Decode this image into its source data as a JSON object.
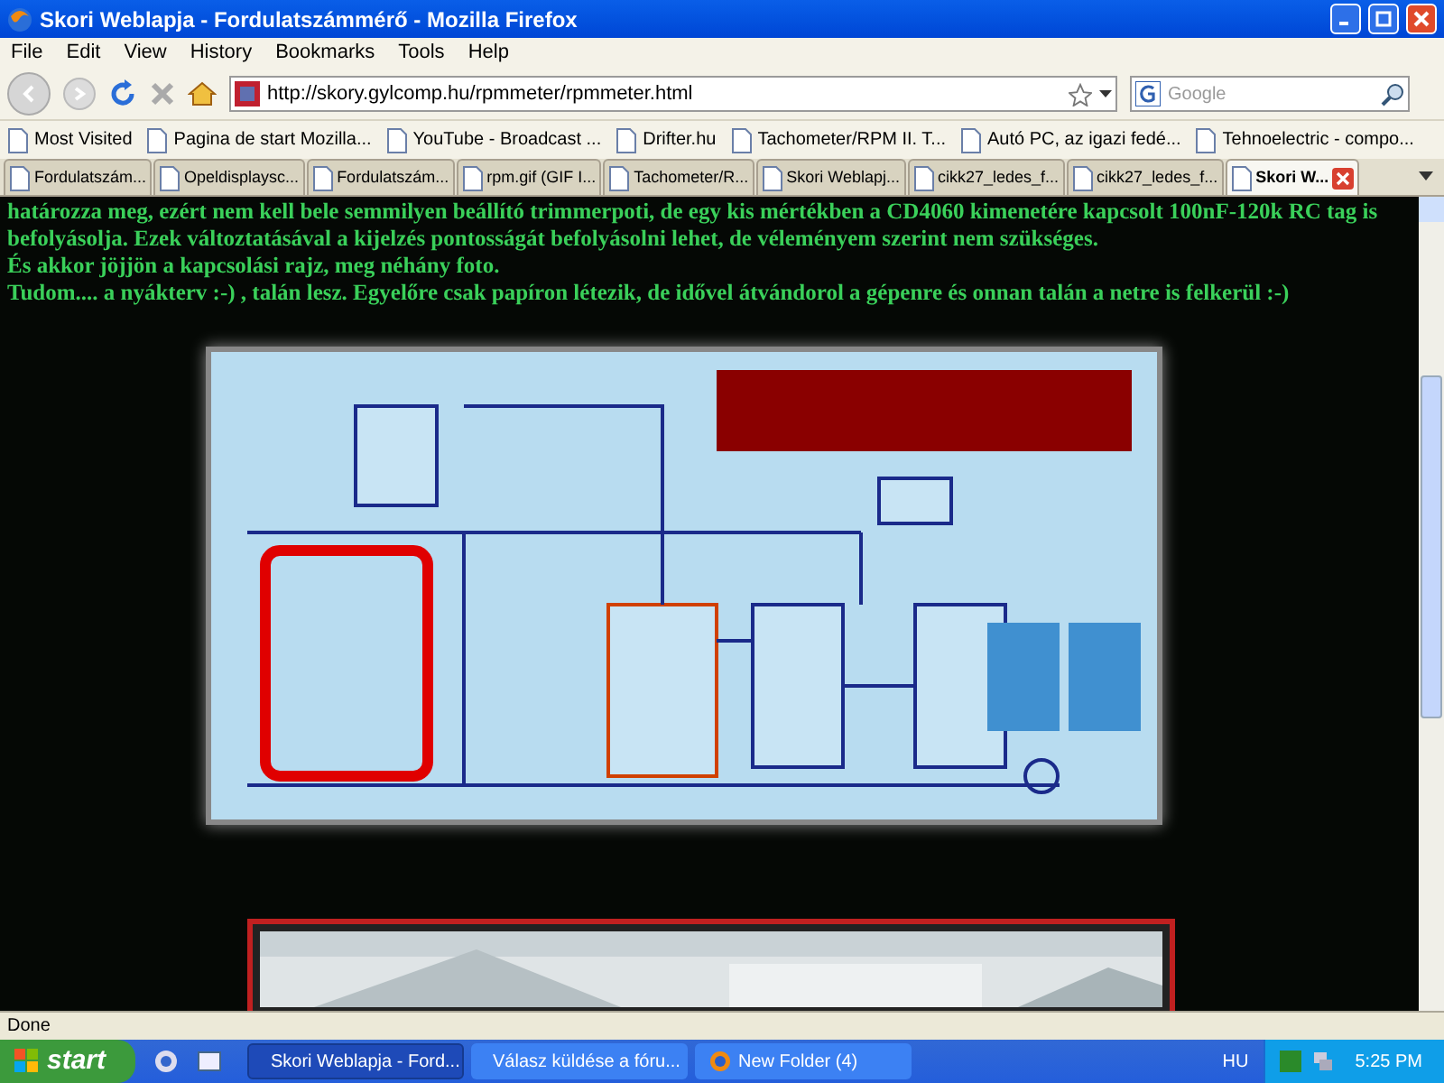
{
  "window": {
    "title": "Skori Weblapja - Fordulatszámmérő - Mozilla Firefox"
  },
  "menu": [
    "File",
    "Edit",
    "View",
    "History",
    "Bookmarks",
    "Tools",
    "Help"
  ],
  "toolbar": {
    "url": "http://skory.gylcomp.hu/rpmmeter/rpmmeter.html",
    "search_placeholder": "Google"
  },
  "bookmarks": [
    "Most Visited",
    "Pagina de start Mozilla...",
    "YouTube - Broadcast ...",
    "Drifter.hu",
    "Tachometer/RPM II. T...",
    "Autó PC, az igazi fedé...",
    "Tehnoelectric - compo..."
  ],
  "tabs": [
    {
      "label": "Fordulatszám...",
      "selected": false
    },
    {
      "label": "Opeldisplaysc...",
      "selected": false
    },
    {
      "label": "Fordulatszám...",
      "selected": false
    },
    {
      "label": "rpm.gif (GIF I...",
      "selected": false
    },
    {
      "label": "Tachometer/R...",
      "selected": false
    },
    {
      "label": "Skori Weblapj...",
      "selected": false
    },
    {
      "label": "cikk27_ledes_f...",
      "selected": false
    },
    {
      "label": "cikk27_ledes_f...",
      "selected": false
    },
    {
      "label": "Skori W...",
      "selected": true
    }
  ],
  "page": {
    "paragraphs": [
      "határozza meg, ezért nem kell bele semmilyen beállító trimmerpoti, de egy kis mértékben a CD4060 kimenetére kapcsolt 100nF-120k RC tag is befolyásolja. Ezek változtatásával a kijelzés pontosságát befolyásolni lehet, de véleményem szerint nem szükséges.",
      "És akkor jöjjön a kapcsolási rajz, meg néhány foto.",
      "Tudom.... a nyákterv :-) , talán lesz. Egyelőre csak papíron létezik, de idővel átvándorol a gépenre és onnan talán a netre is felkerül :-)"
    ]
  },
  "status_bar": "Done",
  "taskbar": {
    "start": "start",
    "tasks": [
      {
        "label": "Skori Weblapja - Ford...",
        "selected": true
      },
      {
        "label": "Válasz küldése a fóru...",
        "selected": false
      },
      {
        "label": "New Folder (4)",
        "selected": false
      }
    ],
    "language": "HU",
    "clock": "5:25 PM"
  }
}
